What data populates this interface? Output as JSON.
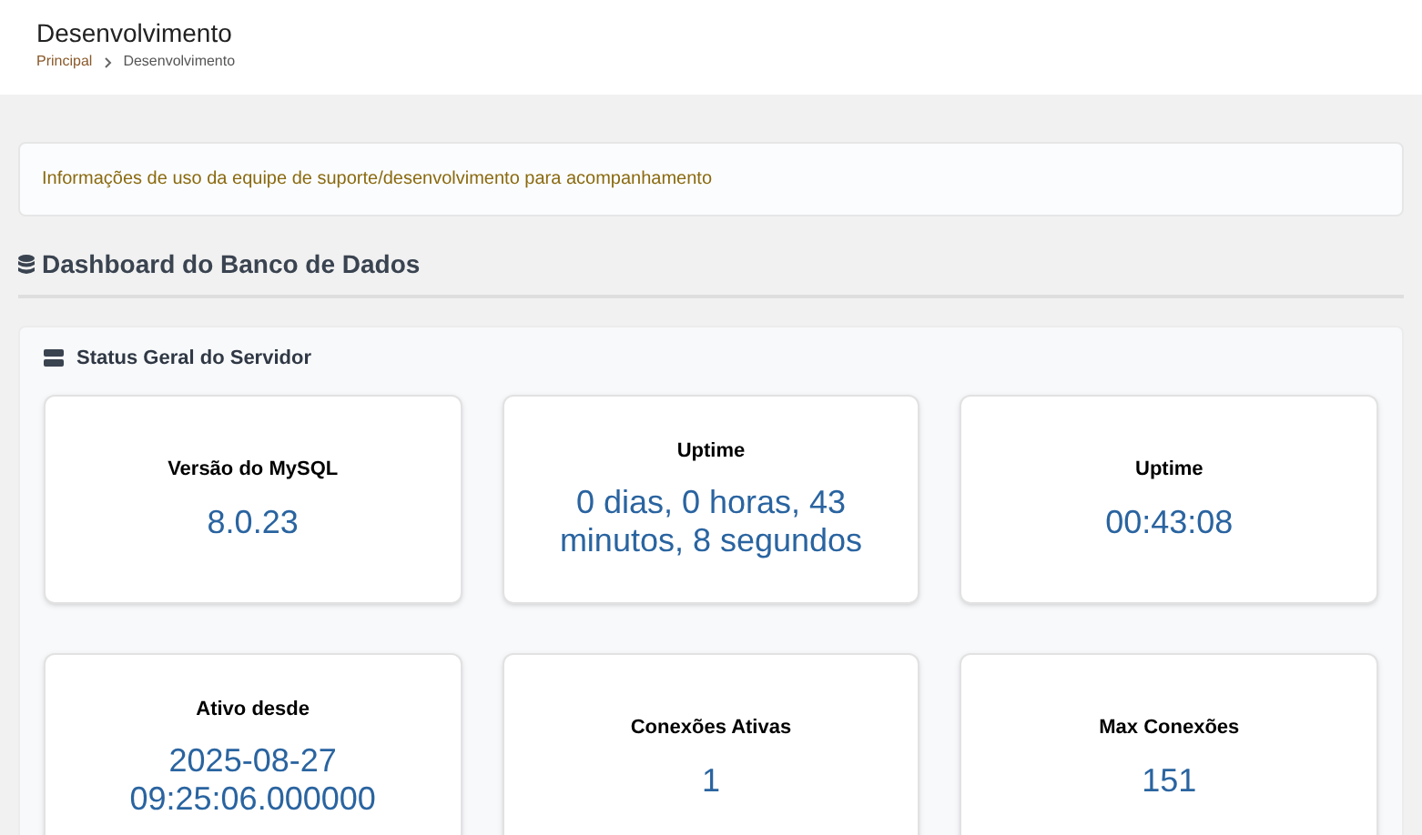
{
  "header": {
    "title": "Desenvolvimento",
    "breadcrumb": [
      "Principal",
      "Desenvolvimento"
    ]
  },
  "info": "Informações de uso da equipe de suporte/desenvolvimento para acompanhamento",
  "section_title": "Dashboard do Banco de Dados",
  "panel": {
    "title": "Status Geral do Servidor",
    "cards": [
      {
        "label": "Versão do MySQL",
        "value": "8.0.23"
      },
      {
        "label": "Uptime",
        "value": "0 dias, 0 horas, 43 minutos, 8 segundos"
      },
      {
        "label": "Uptime",
        "value": "00:43:08"
      },
      {
        "label": "Ativo desde",
        "value": "2025-08-27 09:25:06.000000"
      },
      {
        "label": "Conexões Ativas",
        "value": "1"
      },
      {
        "label": "Max Conexões",
        "value": "151"
      }
    ]
  }
}
